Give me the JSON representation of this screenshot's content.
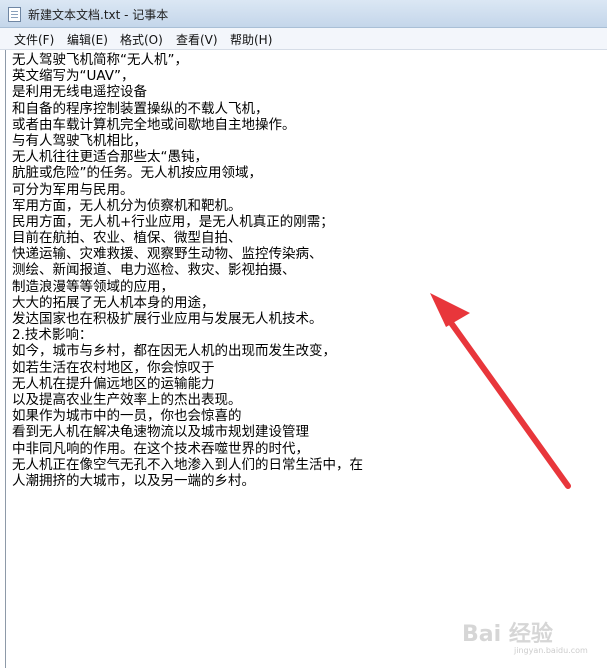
{
  "window": {
    "title": "新建文本文档.txt - 记事本",
    "icon": "notepad-icon"
  },
  "menu": [
    {
      "label": "文件(F)"
    },
    {
      "label": "编辑(E)"
    },
    {
      "label": "格式(O)"
    },
    {
      "label": "查看(V)"
    },
    {
      "label": "帮助(H)"
    }
  ],
  "document": {
    "lines": [
      "无人驾驶飞机简称“无人机”，",
      "英文缩写为“UAV”，",
      "是利用无线电遥控设备",
      "和自备的程序控制装置操纵的不载人飞机，",
      "或者由车载计算机完全地或间歇地自主地操作。",
      "与有人驾驶飞机相比，",
      "无人机往往更适合那些太“愚钝，",
      "肮脏或危险”的任务。无人机按应用领域，",
      "可分为军用与民用。",
      "军用方面，无人机分为侦察机和靶机。",
      "民用方面，无人机+行业应用，是无人机真正的刚需；",
      "目前在航拍、农业、植保、微型自拍、",
      "快递运输、灾难救援、观察野生动物、监控传染病、",
      "测绘、新闻报道、电力巡检、救灾、影视拍摄、",
      "制造浪漫等等领域的应用，",
      "大大的拓展了无人机本身的用途，",
      "发达国家也在积极扩展行业应用与发展无人机技术。",
      "2.技术影响：",
      "如今，城市与乡村，都在因无人机的出现而发生改变，",
      "如若生活在农村地区，你会惊叹于",
      "无人机在提升偏远地区的运输能力",
      "以及提高农业生产效率上的杰出表现。",
      "如果作为城市中的一员，你也会惊喜的",
      "看到无人机在解决龟速物流以及城市规划建设管理",
      "中非同凡响的作用。在这个技术吞噬世界的时代，",
      "无人机正在像空气无孔不入地渗入到人们的日常生活中，在",
      "人潮拥挤的大城市，以及另一端的乡村。"
    ]
  },
  "annotation": {
    "type": "arrow",
    "color": "#e8363b"
  },
  "watermark": {
    "text": "Bai 经验",
    "sub": "jingyan.baidu.com"
  }
}
